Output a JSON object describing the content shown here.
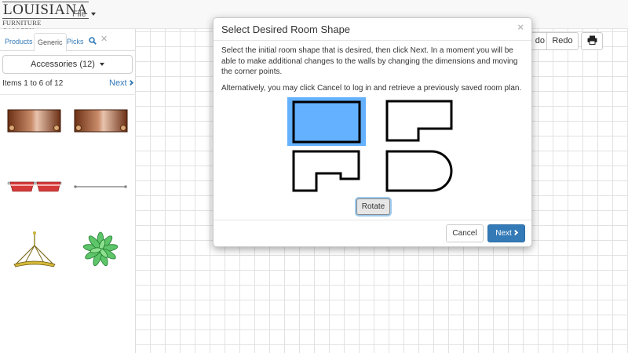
{
  "header": {
    "logo_line1": "LOUISIANA",
    "logo_line2": "FURNITURE GALLERY",
    "file_menu": "File"
  },
  "sidebar": {
    "tabs": [
      "Products",
      "Generic",
      "Picks"
    ],
    "active_tab": "Generic",
    "search_icon": "search-icon",
    "close_icon": "close-icon",
    "category": "Accessories (12)",
    "items_count": "Items 1 to 6 of 12",
    "next_label": "Next",
    "thumbnails": [
      "wood-bench",
      "wood-bench",
      "red-planters",
      "rod",
      "hanging-lamp",
      "plant"
    ]
  },
  "toolbar": {
    "undo_label": "do",
    "redo_label": "Redo",
    "print_icon": "print-icon"
  },
  "modal": {
    "title": "Select Desired Room Shape",
    "close_glyph": "×",
    "text1": "Select the initial room shape that is desired, then click Next. In a moment you will be able to make additional changes to the walls by changing the dimensions and moving the corner points.",
    "text2": "Alternatively, you may click Cancel to log in and retrieve a previously saved room plan.",
    "shapes": [
      "rectangle",
      "l-shape",
      "notched",
      "rounded-end"
    ],
    "selected_shape": "rectangle",
    "rotate_label": "Rotate",
    "cancel_label": "Cancel",
    "next_label": "Next"
  },
  "colors": {
    "accent": "#337ab7",
    "selected_shape_bg": "#63b1ff",
    "grid": "#e2e2e2"
  }
}
